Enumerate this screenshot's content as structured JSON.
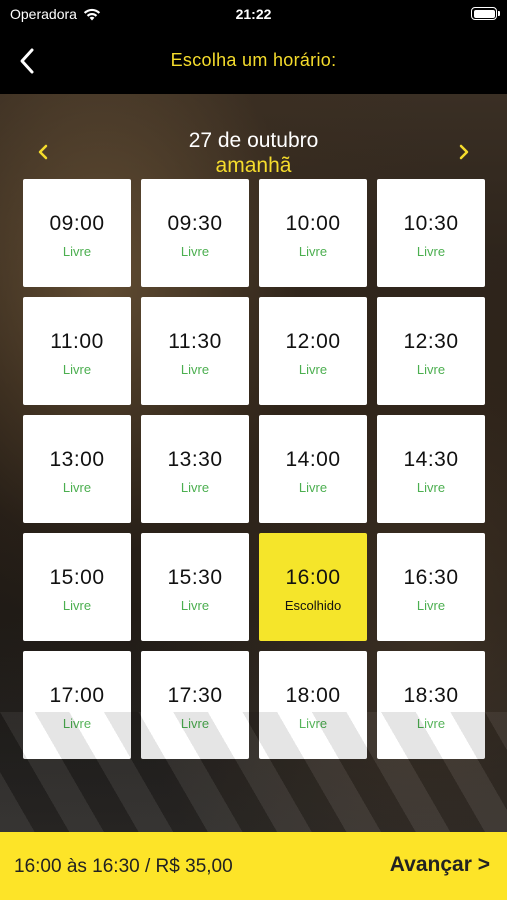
{
  "status_bar": {
    "carrier": "Operadora",
    "time": "21:22"
  },
  "header": {
    "title": "Escolha um horário:",
    "back_icon": "chevron-left-icon"
  },
  "date_nav": {
    "date": "27 de outubro",
    "relative": "amanhã",
    "prev_icon": "chevron-left-icon",
    "next_icon": "chevron-right-icon"
  },
  "slots": [
    {
      "time": "09:00",
      "status": "Livre"
    },
    {
      "time": "09:30",
      "status": "Livre"
    },
    {
      "time": "10:00",
      "status": "Livre"
    },
    {
      "time": "10:30",
      "status": "Livre"
    },
    {
      "time": "11:00",
      "status": "Livre"
    },
    {
      "time": "11:30",
      "status": "Livre"
    },
    {
      "time": "12:00",
      "status": "Livre"
    },
    {
      "time": "12:30",
      "status": "Livre"
    },
    {
      "time": "13:00",
      "status": "Livre"
    },
    {
      "time": "13:30",
      "status": "Livre"
    },
    {
      "time": "14:00",
      "status": "Livre"
    },
    {
      "time": "14:30",
      "status": "Livre"
    },
    {
      "time": "15:00",
      "status": "Livre"
    },
    {
      "time": "15:30",
      "status": "Livre"
    },
    {
      "time": "16:00",
      "status": "Escolhido"
    },
    {
      "time": "16:30",
      "status": "Livre"
    },
    {
      "time": "17:00",
      "status": "Livre"
    },
    {
      "time": "17:30",
      "status": "Livre"
    },
    {
      "time": "18:00",
      "status": "Livre"
    },
    {
      "time": "18:30",
      "status": "Livre"
    }
  ],
  "colors": {
    "accent": "#f5dc2c",
    "available": "#4caf50",
    "selected_bg": "#f5e52a",
    "bottom_bar_bg": "#fde428"
  },
  "footer": {
    "summary": "16:00 às 16:30 / R$ 35,00",
    "advance_label": "Avançar >"
  }
}
